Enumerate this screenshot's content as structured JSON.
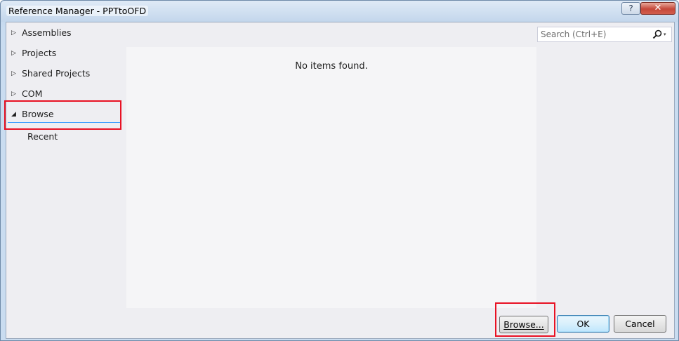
{
  "window": {
    "title": "Reference Manager - PPTtoOFD",
    "help_label": "?",
    "close_label": "✕"
  },
  "sidebar": {
    "items": [
      {
        "label": "Assemblies",
        "arrow": "▷",
        "expanded": false
      },
      {
        "label": "Projects",
        "arrow": "▷",
        "expanded": false
      },
      {
        "label": "Shared Projects",
        "arrow": "▷",
        "expanded": false
      },
      {
        "label": "COM",
        "arrow": "▷",
        "expanded": false
      },
      {
        "label": "Browse",
        "arrow": "◢",
        "expanded": true,
        "selected": true
      }
    ],
    "subitems": [
      {
        "label": "Recent"
      }
    ]
  },
  "content": {
    "empty_message": "No items found."
  },
  "search": {
    "placeholder": "Search (Ctrl+E)",
    "value": "",
    "dropdown_glyph": "▾"
  },
  "footer": {
    "browse_label": "Browse...",
    "ok_label": "OK",
    "cancel_label": "Cancel"
  },
  "annotations": {
    "highlight_color": "#e81123"
  },
  "colors": {
    "accent": "#3399ff",
    "panel_background": "#eeeef2",
    "content_background": "#f5f5f7"
  }
}
